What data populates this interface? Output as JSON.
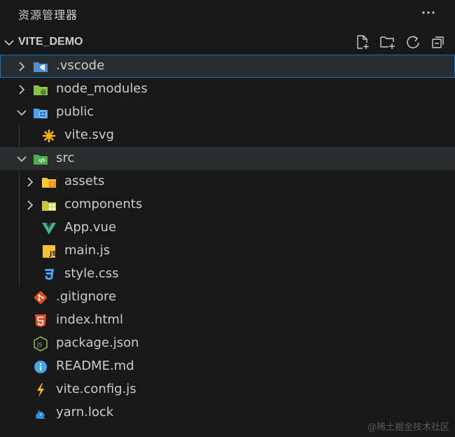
{
  "titlebar": {
    "title": "资源管理器",
    "more_icon": "ellipsis-icon"
  },
  "section": {
    "label": "VITE_DEMO",
    "actions": [
      "new-file-icon",
      "new-folder-icon",
      "refresh-icon",
      "collapse-all-icon"
    ]
  },
  "tree": {
    "vscode": ".vscode",
    "node_modules": "node_modules",
    "public": "public",
    "vite_svg": "vite.svg",
    "src": "src",
    "assets": "assets",
    "components": "components",
    "app_vue": "App.vue",
    "main_js": "main.js",
    "style_css": "style.css",
    "gitignore": ".gitignore",
    "index_html": "index.html",
    "package_json": "package.json",
    "readme": "README.md",
    "vite_config": "vite.config.js",
    "yarn_lock": "yarn.lock"
  },
  "watermark": "@稀土掘金技术社区",
  "colors": {
    "background": "#181818",
    "selection_border": "#0078d4",
    "hover": "#2a2d2e",
    "text": "#cccccc"
  }
}
